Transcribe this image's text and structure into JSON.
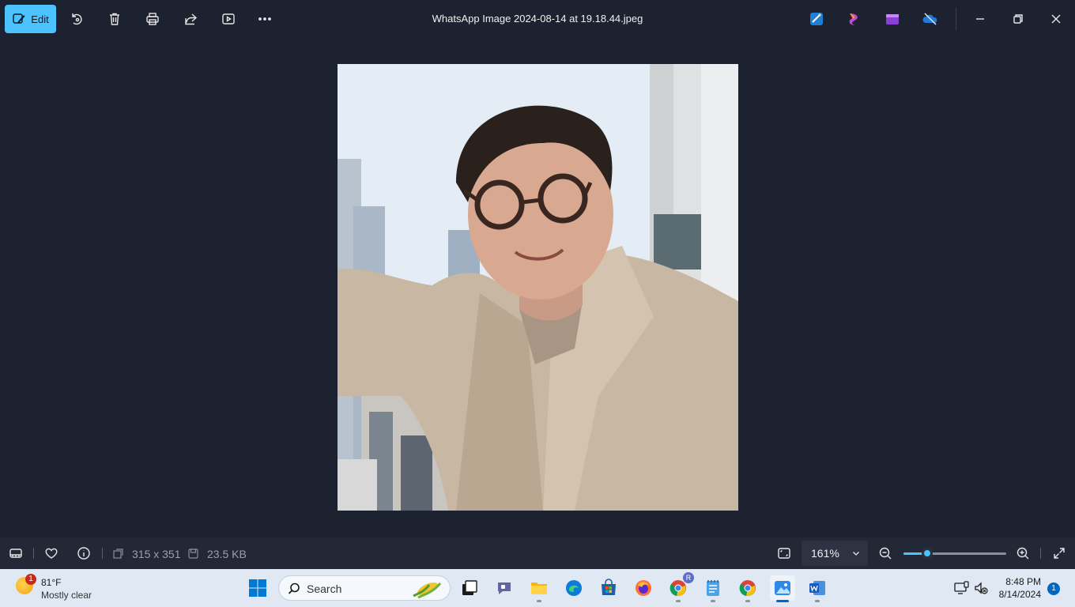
{
  "toolbar": {
    "edit_label": "Edit",
    "title": "WhatsApp Image 2024-08-14 at 19.18.44.jpeg"
  },
  "status": {
    "dimensions": "315 x 351",
    "file_size": "23.5 KB",
    "zoom": "161%",
    "zoom_level_fraction": 0.23
  },
  "taskbar": {
    "weather_temp": "81°F",
    "weather_desc": "Mostly clear",
    "weather_badge": "1",
    "search_placeholder": "Search",
    "chrome_profile_badge": "R",
    "time": "8:48 PM",
    "date": "8/14/2024",
    "notification_count": "1"
  },
  "colors": {
    "accent": "#4cc2ff",
    "background": "#1c2230",
    "taskbar": "#dfe8f3"
  }
}
